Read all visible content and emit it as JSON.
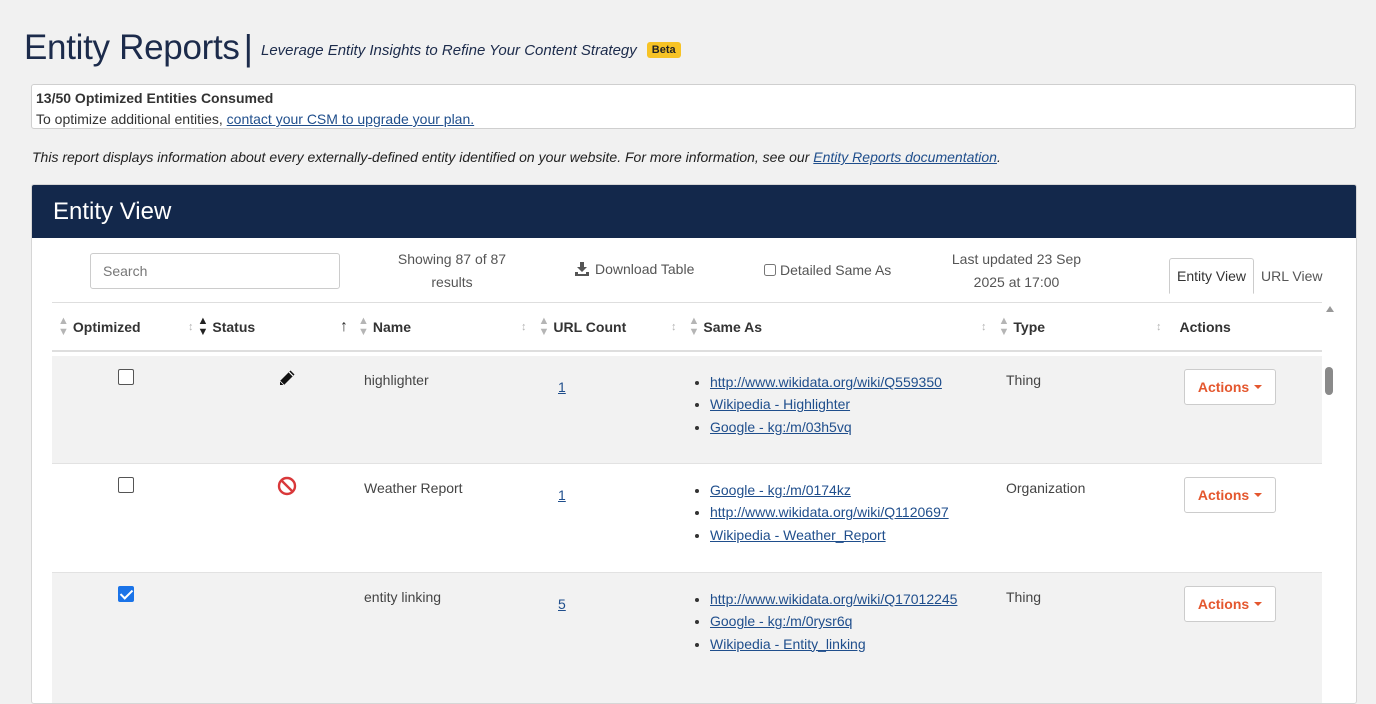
{
  "header": {
    "title": "Entity Reports",
    "separator": "|",
    "subtitle": "Leverage Entity Insights to Refine Your Content Strategy",
    "badge": "Beta"
  },
  "usage": {
    "title": "13/50 Optimized Entities Consumed",
    "text": "To optimize additional entities, ",
    "link": "contact your CSM to upgrade your plan."
  },
  "info": {
    "text": "This report displays information about every externally-defined entity identified on your website. For more information, see our ",
    "link": "Entity Reports documentation",
    "end": "."
  },
  "panel": {
    "title": "Entity View"
  },
  "toolbar": {
    "search_placeholder": "Search",
    "showing_line1": "Showing 87 of 87",
    "showing_line2": "results",
    "download_label": "Download Table",
    "detailed_label": "Detailed Same As",
    "updated_line1": "Last updated 23 Sep",
    "updated_line2": "2025 at 17:00",
    "tabs": [
      {
        "label": "Entity View",
        "active": true
      },
      {
        "label": "URL View",
        "active": false
      }
    ]
  },
  "columns": {
    "optimized": "Optimized",
    "status": "Status",
    "name": "Name",
    "url_count": "URL Count",
    "same_as": "Same As",
    "type": "Type",
    "actions": "Actions"
  },
  "rows": [
    {
      "optimized": false,
      "status_icon": "pencil-icon",
      "name": "highlighter",
      "url_count": "1",
      "same_as": [
        "http://www.wikidata.org/wiki/Q559350",
        "Wikipedia - Highlighter",
        "Google - kg:/m/03h5vq"
      ],
      "type": "Thing",
      "action_label": "Actions"
    },
    {
      "optimized": false,
      "status_icon": "blocked-icon",
      "name": "Weather Report",
      "url_count": "1",
      "same_as": [
        "Google - kg:/m/0174kz",
        "http://www.wikidata.org/wiki/Q1120697",
        "Wikipedia - Weather_Report"
      ],
      "type": "Organization",
      "action_label": "Actions"
    },
    {
      "optimized": true,
      "status_icon": "",
      "name": "entity linking",
      "url_count": "5",
      "same_as": [
        "http://www.wikidata.org/wiki/Q17012245",
        "Google - kg:/m/0rysr6q",
        "Wikipedia - Entity_linking"
      ],
      "type": "Thing",
      "action_label": "Actions"
    }
  ],
  "colors": {
    "navy": "#13284b",
    "link": "#1f4e8c",
    "action_orange": "#e4572e",
    "beta_yellow": "#f7c325",
    "checkbox_blue": "#1a73e8",
    "block_red": "#d9383a"
  }
}
